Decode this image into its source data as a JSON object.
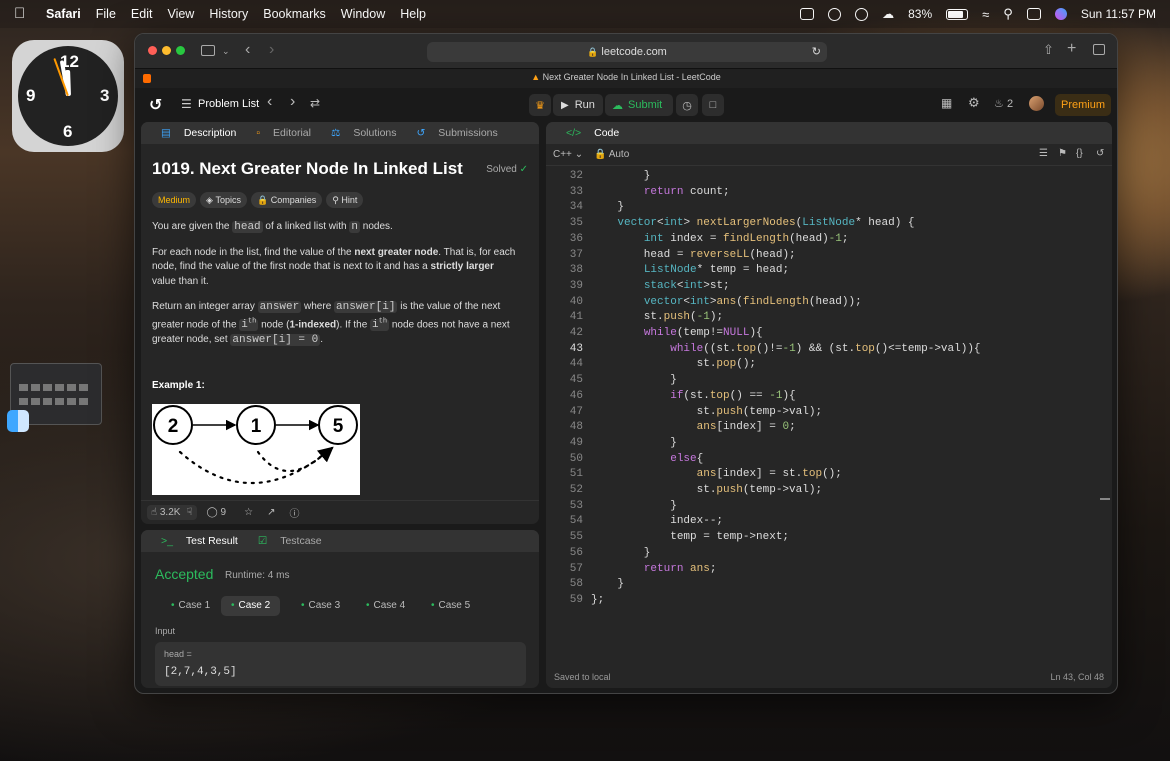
{
  "menubar": {
    "app": "Safari",
    "items": [
      "File",
      "Edit",
      "View",
      "History",
      "Bookmarks",
      "Window",
      "Help"
    ],
    "battery": "83%",
    "clock": "Sun 11:57 PM"
  },
  "clock_widget": {
    "numbers": [
      "12",
      "3",
      "6",
      "9"
    ]
  },
  "browser": {
    "url": "leetcode.com",
    "tab_title": "Next Greater Node In Linked List - LeetCode"
  },
  "toolbar": {
    "problem_list": "Problem List",
    "run": "Run",
    "submit": "Submit",
    "streak": "2",
    "premium": "Premium"
  },
  "description": {
    "tabs": [
      "Description",
      "Editorial",
      "Solutions",
      "Submissions"
    ],
    "title": "1019. Next Greater Node In Linked List",
    "status": "Solved",
    "tags": [
      "Medium",
      "Topics",
      "Companies",
      "Hint"
    ],
    "p1_pre": "You are given the ",
    "p1_code1": "head",
    "p1_mid": " of a linked list with ",
    "p1_code2": "n",
    "p1_post": " nodes.",
    "p2_pre": "For each node in the list, find the value of the ",
    "p2_b1": "next greater node",
    "p2_mid": ". That is, for each node, find the value of the first node that is next to it and has a ",
    "p2_b2": "strictly larger",
    "p2_post": " value than it.",
    "p3_pre": "Return an integer array ",
    "p3_c1": "answer",
    "p3_a": " where ",
    "p3_c2": "answer[i]",
    "p3_b": " is the value of the next greater node of the ",
    "p3_c3": "i",
    "p3_sup1": "th",
    "p3_c": " node (",
    "p3_bold": "1-indexed",
    "p3_d": "). If the ",
    "p3_c4": "i",
    "p3_sup2": "th",
    "p3_e": " node does not have a next greater node, set ",
    "p3_c5": "answer[i] = 0",
    "p3_f": ".",
    "example_title": "Example 1:",
    "example_nodes": [
      "2",
      "1",
      "5"
    ],
    "likes": "3.2K",
    "comments": "9"
  },
  "code_panel": {
    "title": "Code",
    "language": "C++",
    "mode": "Auto",
    "saved": "Saved to local",
    "cursor": "Ln 43, Col 48"
  },
  "code_lines": [
    {
      "n": "32",
      "t": "        }"
    },
    {
      "n": "33",
      "t": "        return count;"
    },
    {
      "n": "34",
      "t": "    }"
    },
    {
      "n": "35",
      "t": "    vector<int> nextLargerNodes(ListNode* head) {"
    },
    {
      "n": "36",
      "t": "        int index = findLength(head)-1;"
    },
    {
      "n": "37",
      "t": "        head = reverseLL(head);"
    },
    {
      "n": "38",
      "t": "        ListNode* temp = head;"
    },
    {
      "n": "39",
      "t": "        stack<int>st;"
    },
    {
      "n": "40",
      "t": "        vector<int>ans(findLength(head));"
    },
    {
      "n": "41",
      "t": "        st.push(-1);"
    },
    {
      "n": "42",
      "t": "        while(temp!=NULL){"
    },
    {
      "n": "43",
      "t": "            while((st.top()!=-1) && (st.top()<=temp->val)){"
    },
    {
      "n": "44",
      "t": "                st.pop();"
    },
    {
      "n": "45",
      "t": "            }"
    },
    {
      "n": "46",
      "t": "            if(st.top() == -1){"
    },
    {
      "n": "47",
      "t": "                st.push(temp->val);"
    },
    {
      "n": "48",
      "t": "                ans[index] = 0;"
    },
    {
      "n": "49",
      "t": "            }"
    },
    {
      "n": "50",
      "t": "            else{"
    },
    {
      "n": "51",
      "t": "                ans[index] = st.top();"
    },
    {
      "n": "52",
      "t": "                st.push(temp->val);"
    },
    {
      "n": "53",
      "t": "            }"
    },
    {
      "n": "54",
      "t": "            index--;"
    },
    {
      "n": "55",
      "t": "            temp = temp->next;"
    },
    {
      "n": "56",
      "t": "        }"
    },
    {
      "n": "57",
      "t": "        return ans;"
    },
    {
      "n": "58",
      "t": "    }"
    },
    {
      "n": "59",
      "t": "};"
    }
  ],
  "result": {
    "tabs": [
      "Test Result",
      "Testcase"
    ],
    "status": "Accepted",
    "runtime": "Runtime: 4 ms",
    "cases": [
      "Case 1",
      "Case 2",
      "Case 3",
      "Case 4",
      "Case 5"
    ],
    "input_label": "Input",
    "var_label": "head =",
    "var_value": "[2,7,4,3,5]"
  },
  "colors": {
    "accepted": "#2cbb5d",
    "premium": "#ffa116",
    "medium": "#ffb800"
  }
}
